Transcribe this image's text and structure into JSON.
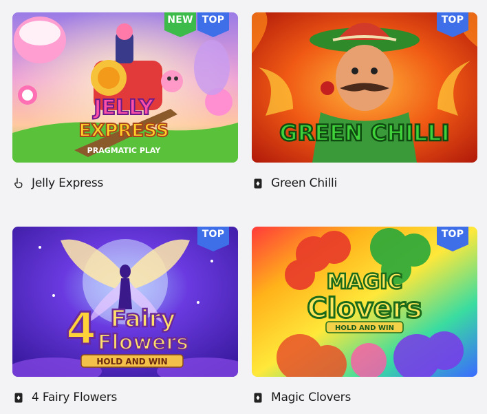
{
  "games": [
    {
      "name": "Jelly Express",
      "provider_icon": "finger-icon",
      "badges": [
        "NEW",
        "TOP"
      ],
      "art": {
        "line1": "JELLY",
        "line2": "EXPRESS",
        "line3": "PRAGMATIC PLAY"
      }
    },
    {
      "name": "Green Chilli",
      "provider_icon": "playing-card-icon",
      "badges": [
        "TOP"
      ],
      "art": {
        "line1": "GREEN CHILLI"
      }
    },
    {
      "name": "4 Fairy Flowers",
      "provider_icon": "playing-card-icon",
      "badges": [
        "TOP"
      ],
      "art": {
        "line1": "4",
        "line2": "Fairy",
        "line3": "Flowers",
        "line4": "HOLD AND WIN"
      }
    },
    {
      "name": "Magic Clovers",
      "provider_icon": "playing-card-icon",
      "badges": [
        "TOP"
      ],
      "art": {
        "line1": "MAGIC",
        "line2": "Clovers",
        "line3": "HOLD AND WIN"
      }
    }
  ],
  "colors": {
    "top_badge": "#3f6fe8",
    "new_badge": "#3dbb4a",
    "caption_text": "#1a1a1a"
  }
}
